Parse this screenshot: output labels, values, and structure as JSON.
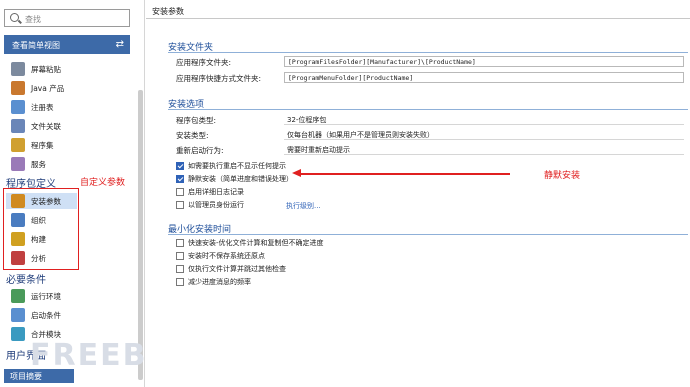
{
  "sidebar": {
    "search_placeholder": "查找",
    "simple_view_label": "查看简单视图",
    "items_top": [
      {
        "label": "屏幕粘贴",
        "icon": "clipboard-icon",
        "color": "#7c8a9e"
      },
      {
        "label": "Java 产品",
        "icon": "java-icon",
        "color": "#c9782e"
      },
      {
        "label": "注册表",
        "icon": "registry-icon",
        "color": "#5a8fd0"
      },
      {
        "label": "文件关联",
        "icon": "file-association-icon",
        "color": "#6a86b8"
      },
      {
        "label": "程序集",
        "icon": "assembly-icon",
        "color": "#d0a030"
      },
      {
        "label": "服务",
        "icon": "service-icon",
        "color": "#9a7ab8"
      }
    ],
    "section_package": "程序包定义",
    "package_annotation": "自定义参数",
    "items_package": [
      {
        "label": "安装参数",
        "icon": "install-params-icon",
        "color": "#d08a20",
        "selected": true
      },
      {
        "label": "组织",
        "icon": "organization-icon",
        "color": "#4a7cc0"
      },
      {
        "label": "构建",
        "icon": "build-icon",
        "color": "#d0a020"
      },
      {
        "label": "分析",
        "icon": "analysis-icon",
        "color": "#c04040"
      }
    ],
    "section_requirements": "必要条件",
    "items_requirements": [
      {
        "label": "运行环境",
        "icon": "runtime-icon",
        "color": "#4a9a5a"
      },
      {
        "label": "启动条件",
        "icon": "launch-conditions-icon",
        "color": "#5a8fd0"
      },
      {
        "label": "合并模块",
        "icon": "merge-module-icon",
        "color": "#3a9ac0"
      }
    ],
    "section_ui": "用户界面",
    "project_summary_label": "项目摘要",
    "watermark": "FREEBUF"
  },
  "main": {
    "page_title": "安装参数",
    "install_folder": {
      "group_title": "安装文件夹",
      "app_folder_label": "应用程序文件夹:",
      "app_folder_value": "[ProgramFilesFolder][Manufacturer]\\[ProductName]",
      "shortcut_folder_label": "应用程序快捷方式文件夹:",
      "shortcut_folder_value": "[ProgramMenuFolder][ProductName]"
    },
    "install_options": {
      "group_title": "安装选项",
      "package_type_label": "程序包类型:",
      "package_type_value": "32-位程序包",
      "install_type_label": "安装类型:",
      "install_type_value": "仅每台机器（如果用户不是管理员则安装失败）",
      "reboot_label": "重新启动行为:",
      "reboot_value": "需要时重新启动提示",
      "checks": [
        {
          "label": "如需要执行重启不显示任何提示",
          "checked": true
        },
        {
          "label": "静默安装（简单进度和错误处理）",
          "checked": true
        },
        {
          "label": "启用详细日志记录",
          "checked": false
        },
        {
          "label": "以管理员身份运行",
          "checked": false
        }
      ],
      "exec_link": "执行级别..."
    },
    "minimize_time": {
      "group_title": "最小化安装时间",
      "checks": [
        {
          "label": "快速安装-优化文件计算和复制但不确定进度",
          "checked": false
        },
        {
          "label": "安装时不保存系统还原点",
          "checked": false
        },
        {
          "label": "仅执行文件计算并跳过其他检查",
          "checked": false
        },
        {
          "label": "减少进度消息的频率",
          "checked": false
        }
      ]
    },
    "silent_annotation": "静默安装"
  },
  "colors": {
    "accent": "#3d6aa8",
    "annotation_red": "#e02020",
    "group_blue": "#1f4f9a"
  }
}
